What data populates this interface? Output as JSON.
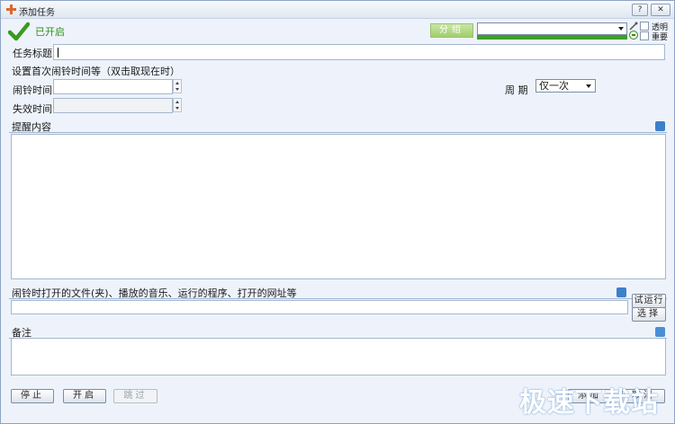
{
  "window": {
    "title": "添加任务",
    "help_label": "?",
    "close_label": "✕"
  },
  "status": {
    "text": "已开启"
  },
  "toolbar": {
    "group_button": "分组",
    "group_select_value": "",
    "transparent_label": "透明",
    "important_label": "重要"
  },
  "task": {
    "title_label": "任务标题",
    "title_value": ""
  },
  "first_alarm": {
    "section_label": "设置首次闹铃时间等（双击取现在时）",
    "alarm_time_label": "闹铃时间",
    "alarm_time_value": "",
    "expire_time_label": "失效时间",
    "expire_time_value": "",
    "period_label": "周  期",
    "period_value": "仅一次"
  },
  "reminder": {
    "section_label": "提醒内容",
    "content": ""
  },
  "open_file": {
    "section_label": "闹铃时打开的文件(夹)、播放的音乐、运行的程序、打开的网址等",
    "value": "",
    "try_run_button": "试运行",
    "choose_button": "选择"
  },
  "notes": {
    "section_label": "备注",
    "content": ""
  },
  "footer": {
    "stop_button": "停止",
    "start_button": "开启",
    "skip_button": "跳过",
    "add_button": "添加",
    "cancel_button": "取消"
  },
  "watermark": "极速下载站",
  "colors": {
    "status_green": "#2f8f1f",
    "group_button_green": "#9fcf6b",
    "progress_green": "#3aa02a",
    "divider_blue": "#9fb4d0",
    "background": "#eef3fb"
  }
}
